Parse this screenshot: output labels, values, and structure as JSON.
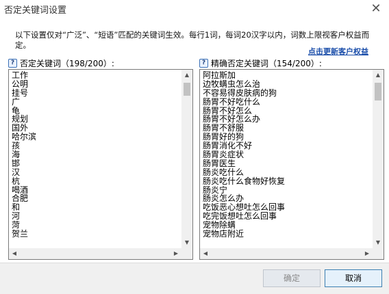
{
  "window": {
    "title": "否定关键词设置",
    "close_label": "✕"
  },
  "description": "以下设置仅对“广泛”、“短语”匹配的关键词生效。每行1词，每词20汉字以内，词数上限视客户权益而定。",
  "refresh_link": "点击更新客户权益",
  "left_panel": {
    "help_label": "?",
    "title": "否定关键词（198/200）:",
    "items": [
      "工作",
      "公明",
      "挂号",
      "广",
      "龟",
      "规划",
      "国外",
      "哈尔滨",
      "孩",
      "海",
      "邯",
      "汉",
      "杭",
      "喝酒",
      "合肥",
      "和",
      "河",
      "菏",
      "贺兰"
    ]
  },
  "right_panel": {
    "help_label": "?",
    "title": "精确否定关键词（154/200）:",
    "items": [
      "阿拉斯加",
      "边牧螨虫怎么治",
      "不容易得皮肤病的狗",
      "肠胃不好吃什么",
      "肠胃不好怎么",
      "肠胃不好怎么办",
      "肠胃不舒服",
      "肠胃好的狗",
      "肠胃消化不好",
      "肠胃炎症状",
      "肠胃医生",
      "肠炎吃什么",
      "肠炎吃什么食物好恢复",
      "肠炎宁",
      "肠炎怎么办",
      "吃饭恶心想吐怎么回事",
      "吃完饭想吐怎么回事",
      "宠物除螨",
      "宠物店附近"
    ]
  },
  "buttons": {
    "ok": "确定",
    "cancel": "取消"
  },
  "scroll_glyphs": {
    "up": "▲",
    "down": "▼",
    "left": "◀",
    "right": "▶"
  }
}
